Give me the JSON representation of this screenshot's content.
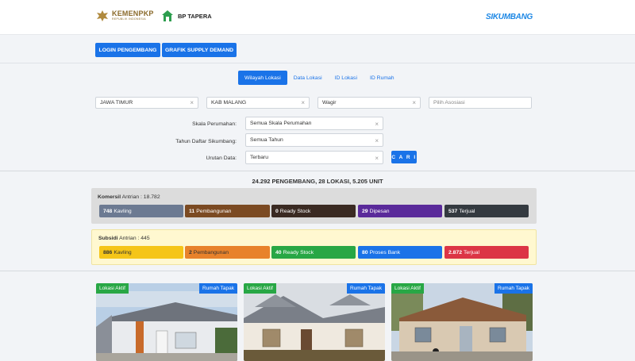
{
  "header": {
    "kemen_logo_text": "KEMENPKP",
    "kemen_logo_sub": "REPUBLIK INDONESIA",
    "tapera_logo_text": "BP TAPERA",
    "sikumbang_logo_text": "SIKUMBANG"
  },
  "nav": {
    "login_label": "LOGIN PENGEMBANG",
    "grafik_label": "GRAFIK SUPPLY DEMAND"
  },
  "tabs": [
    {
      "label": "Wilayah Lokasi",
      "active": true
    },
    {
      "label": "Data Lokasi",
      "active": false
    },
    {
      "label": "ID Lokasi",
      "active": false
    },
    {
      "label": "ID Rumah",
      "active": false
    }
  ],
  "filters": {
    "provinsi": "JAWA TIMUR",
    "kabupaten": "KAB MALANG",
    "kecamatan": "Wagir",
    "asosiasi_placeholder": "Pilih Asosiasi",
    "skala_label": "Skala Perumahan:",
    "skala_value": "Semua Skala Perumahan",
    "tahun_label": "Tahun Daftar Sikumbang:",
    "tahun_value": "Semua Tahun",
    "urutan_label": "Urutan Data:",
    "urutan_value": "Terbaru",
    "search_label": "C A R I",
    "clear_glyph": "×"
  },
  "summary": "24.292 PENGEMBANG, 28 LOKASI, 5.205 UNIT",
  "komersil": {
    "title": "Komersil",
    "antrian": "Antrian : 18.782",
    "stats": [
      {
        "value": "748",
        "label": "Kavling",
        "color": "#6c7a92"
      },
      {
        "value": "11",
        "label": "Pembangunan",
        "color": "#7b4a22"
      },
      {
        "value": "0",
        "label": "Ready Stock",
        "color": "#3a2a22"
      },
      {
        "value": "29",
        "label": "Dipesan",
        "color": "#5a2a9a"
      },
      {
        "value": "537",
        "label": "Terjual",
        "color": "#343a40"
      }
    ]
  },
  "subsidi": {
    "title": "Subsidi",
    "antrian": "Antrian : 445",
    "stats": [
      {
        "value": "886",
        "label": "Kavling",
        "color": "#f5c518"
      },
      {
        "value": "2",
        "label": "Pembangunan",
        "color": "#e8822a"
      },
      {
        "value": "40",
        "label": "Ready Stock",
        "color": "#28a745"
      },
      {
        "value": "80",
        "label": "Proses Bank",
        "color": "#1a73e8"
      },
      {
        "value": "2.872",
        "label": "Terjual",
        "color": "#dc3545"
      }
    ]
  },
  "cards": [
    {
      "status": "Lokasi Aktif",
      "type": "Rumah Tapak"
    },
    {
      "status": "Lokasi Aktif",
      "type": "Rumah Tapak"
    },
    {
      "status": "Lokasi Aktif",
      "type": "Rumah Tapak"
    }
  ]
}
